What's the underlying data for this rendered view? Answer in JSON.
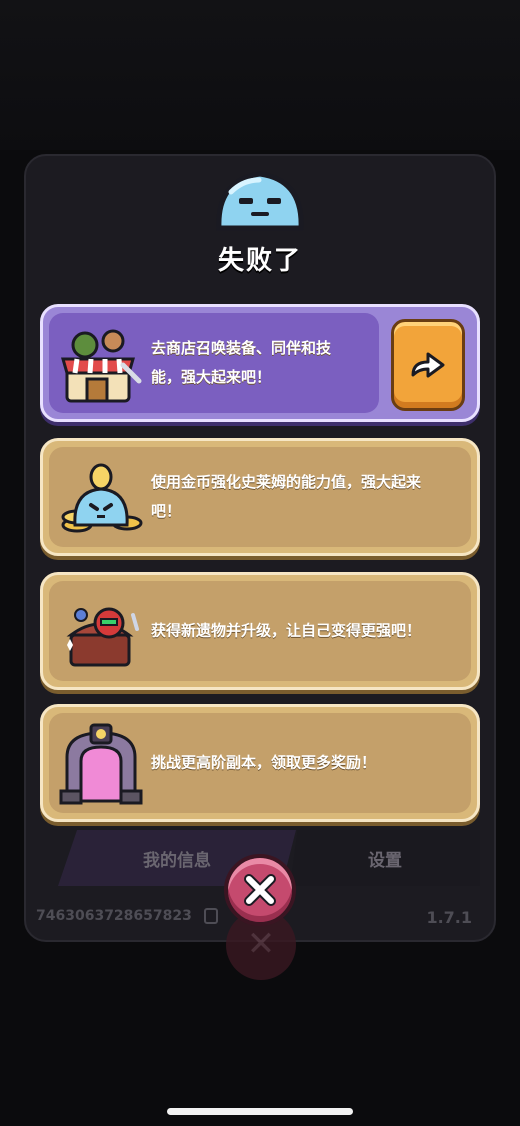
{
  "dialog": {
    "title": "失败了",
    "cards": [
      {
        "id": "shop",
        "text": "去商店召唤装备、同伴和技能，强大起来吧！",
        "icon": "shop-stall-icon",
        "has_go_button": true,
        "go_icon": "arrow-right-icon"
      },
      {
        "id": "gold",
        "text": "使用金币强化史莱姆的能力值，强大起来吧！",
        "icon": "gold-coin-slime-icon"
      },
      {
        "id": "relic",
        "text": "获得新遗物并升级，让自己变得更强吧！",
        "icon": "relic-chest-icon"
      },
      {
        "id": "dungeon",
        "text": "挑战更高阶副本，领取更多奖励！",
        "icon": "dungeon-gate-icon"
      }
    ],
    "close_icon": "close-icon"
  },
  "background": {
    "tabs": [
      "我的信息",
      "设置"
    ],
    "user_id": "7463063728657823",
    "version": "1.7.1"
  },
  "colors": {
    "shop_card": "#7b5fc0",
    "default_card": "#c4a06a",
    "go_button": "#f2a43a",
    "close_button": "#c54a6e"
  }
}
